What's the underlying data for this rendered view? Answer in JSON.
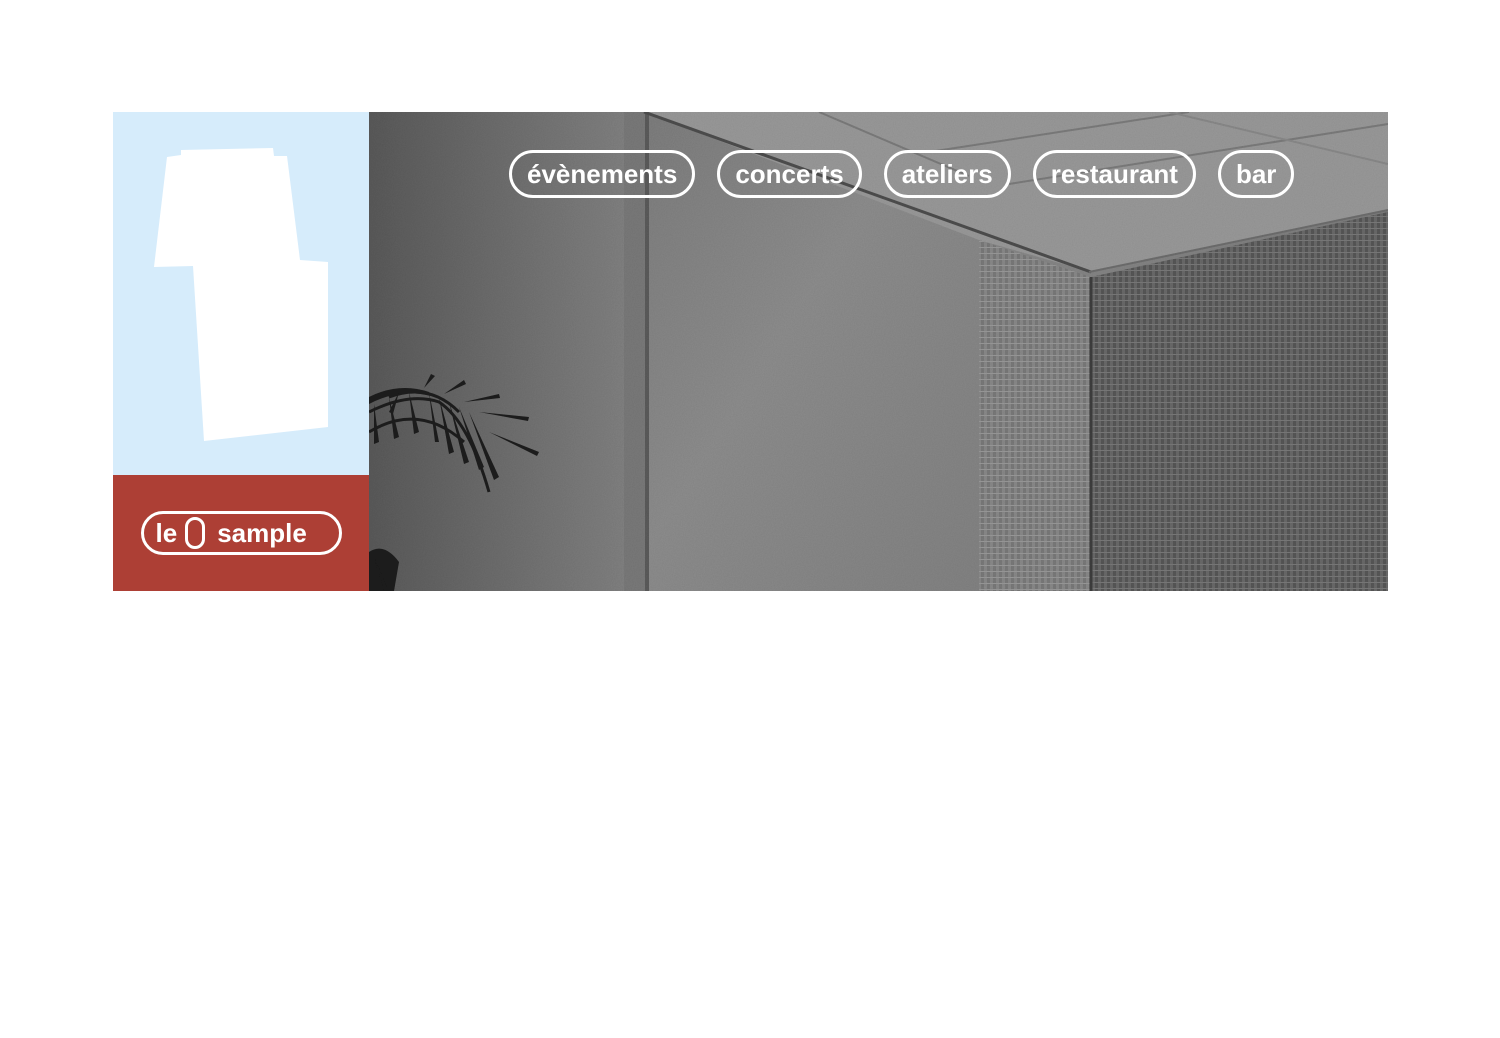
{
  "brand": {
    "prefix": "le",
    "name": "sample",
    "colors": {
      "sky": "#d6ecfb",
      "brick": "#ad3f35",
      "white": "#ffffff"
    }
  },
  "nav": {
    "items": [
      {
        "label": "évènements"
      },
      {
        "label": "concerts"
      },
      {
        "label": "ateliers"
      },
      {
        "label": "restaurant"
      },
      {
        "label": "bar"
      }
    ]
  },
  "hero": {
    "photo": "grayscale-interior-palm-ceiling"
  }
}
